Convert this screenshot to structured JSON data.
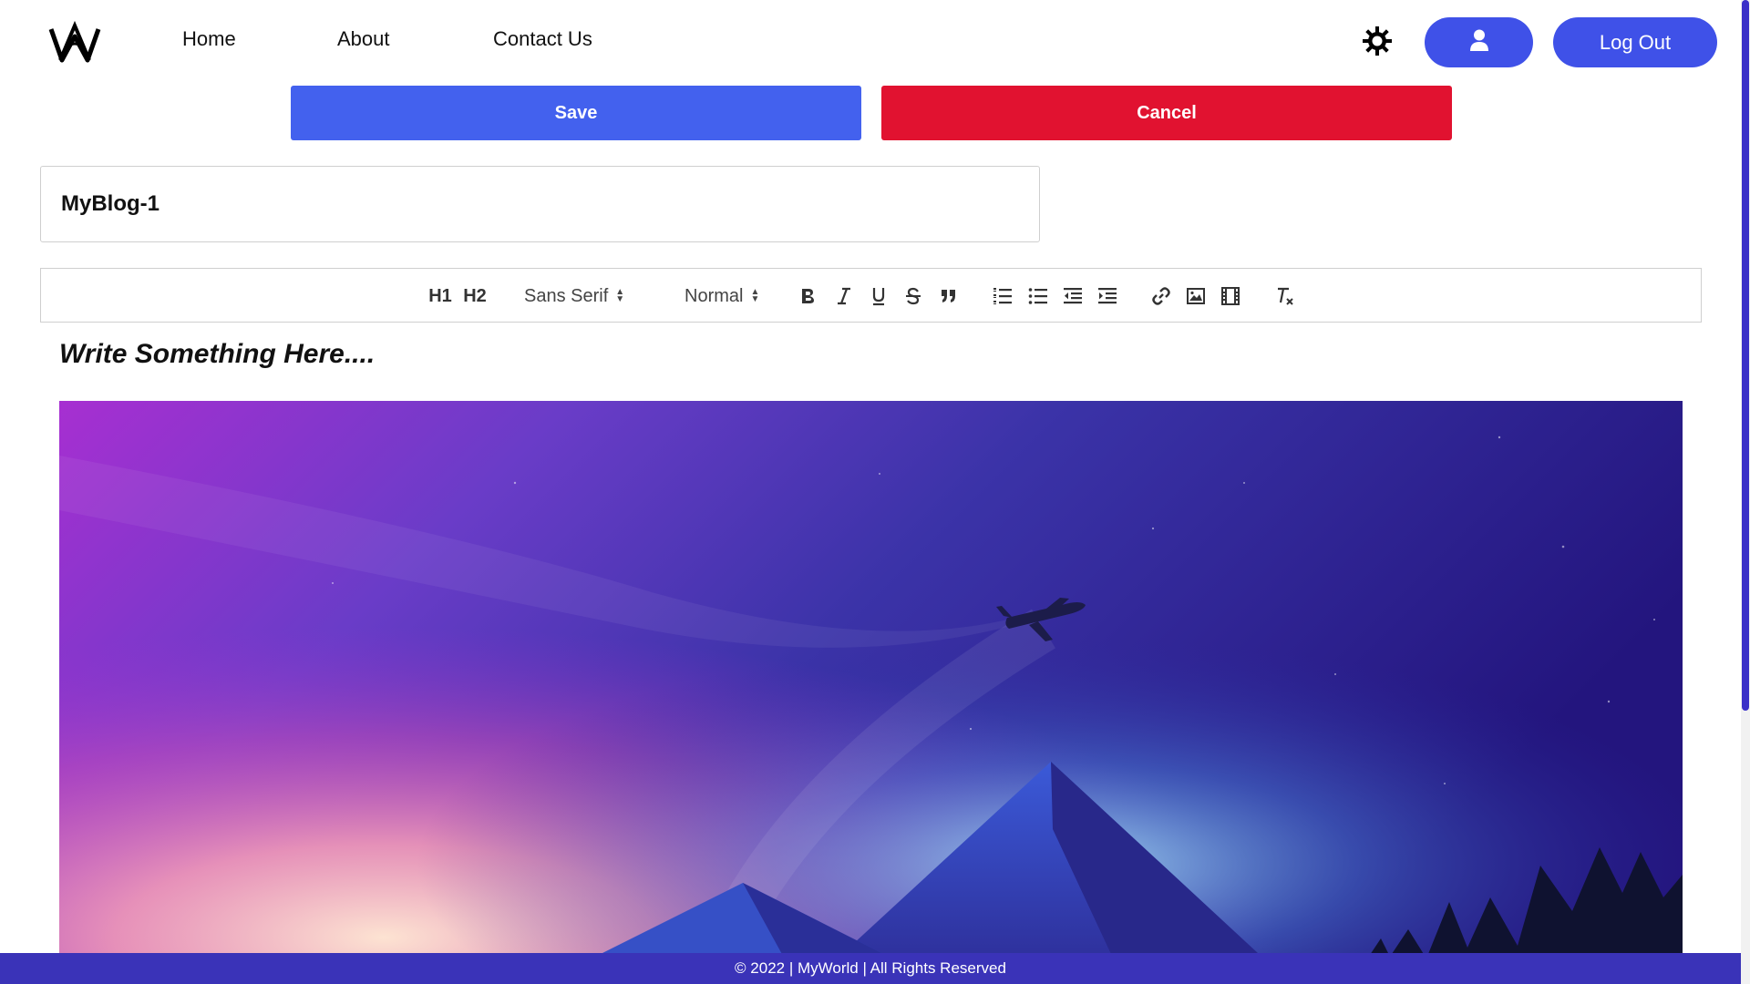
{
  "nav": {
    "links": [
      "Home",
      "About",
      "Contact Us"
    ],
    "logout_label": "Log Out",
    "logo_icon": "crown-logo-icon",
    "theme_icon": "sun-gear-icon",
    "profile_icon": "user-icon",
    "accent": "#3f51e8"
  },
  "actions": {
    "save_label": "Save",
    "cancel_label": "Cancel",
    "save_color": "#4361ee",
    "cancel_color": "#e11230"
  },
  "post": {
    "title_value": "MyBlog-1",
    "placeholder": "Write Something Here...."
  },
  "toolbar": {
    "h1_label": "H1",
    "h2_label": "H2",
    "font_select": "Sans Serif",
    "size_select": "Normal",
    "buttons": [
      "bold",
      "italic",
      "underline",
      "strike",
      "blockquote",
      "ordered-list",
      "bullet-list",
      "outdent",
      "indent",
      "link",
      "image",
      "video",
      "clean"
    ]
  },
  "footer": {
    "text": "© 2022 | MyWorld | All Rights Reserved",
    "color": "#3a33b8"
  }
}
